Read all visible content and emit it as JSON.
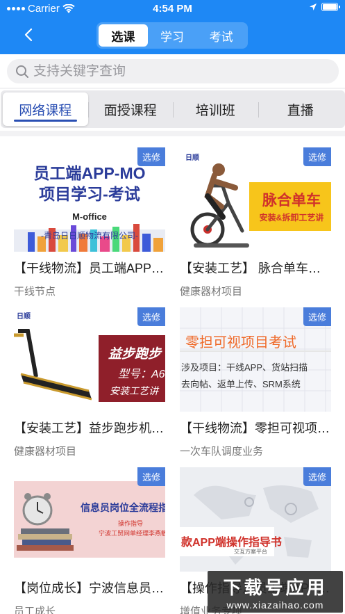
{
  "status_bar": {
    "carrier": "Carrier",
    "time": "4:54 PM"
  },
  "nav": {
    "segments": [
      "选课",
      "学习",
      "考试"
    ],
    "active_segment": 0
  },
  "search": {
    "placeholder": "支持关键字查询"
  },
  "tabs": [
    "网络课程",
    "面授课程",
    "培训班",
    "直播"
  ],
  "active_tab": 0,
  "colors": {
    "accent": "#1e88f5",
    "badge": "#4a7ddb",
    "active_tab_text": "#2a4fb3"
  },
  "courses": [
    {
      "badge": "选修",
      "title": "【干线物流】员工端APP-MO项目学习-考试",
      "category": "干线节点",
      "thumb": {
        "line1": "员工端APP-MO",
        "line2": "项目学习-考试",
        "line3": "M-office",
        "line4": "-青岛日日顺物流有限公司-"
      }
    },
    {
      "badge": "选修",
      "title": "【安装工艺】 脉合单车安装&拆卸工艺讲解",
      "category": "健康器材项目",
      "thumb": {
        "line1": "脉合单车",
        "line2": "安装&拆卸工艺讲",
        "logo": "日顺"
      }
    },
    {
      "badge": "选修",
      "title": "【安装工艺】益步跑步机安装工艺讲解",
      "category": "健康器材项目",
      "thumb": {
        "line1": "益步跑步",
        "line2": "型号：A6",
        "line3": "安装工艺讲",
        "logo": "日顺"
      }
    },
    {
      "badge": "选修",
      "title": "【干线物流】零担可视项目考试",
      "category": "一次车队调度业务",
      "thumb": {
        "line1": "零担可视项目考试",
        "line2": "涉及项目：干线APP、货站扫描",
        "line3": "去向帖、返单上传、SRM系统"
      }
    },
    {
      "badge": "选修",
      "title": "【岗位成长】宁波信息员岗位全流程指导",
      "category": "员工成长",
      "thumb": {
        "line1": "信息员岗位全流程指",
        "line2": "操作指导",
        "line3": "宁波工贸网单经理李燕敏"
      }
    },
    {
      "badge": "选修",
      "title": "【操作指导】员工端APP端操作指导书",
      "category": "增值业务专项",
      "thumb": {
        "line1": "款APP端操作指导书",
        "line2": "交互方案平台"
      }
    }
  ],
  "watermark": {
    "big": "下载号应用",
    "small": "www.xiazaihao.com"
  }
}
